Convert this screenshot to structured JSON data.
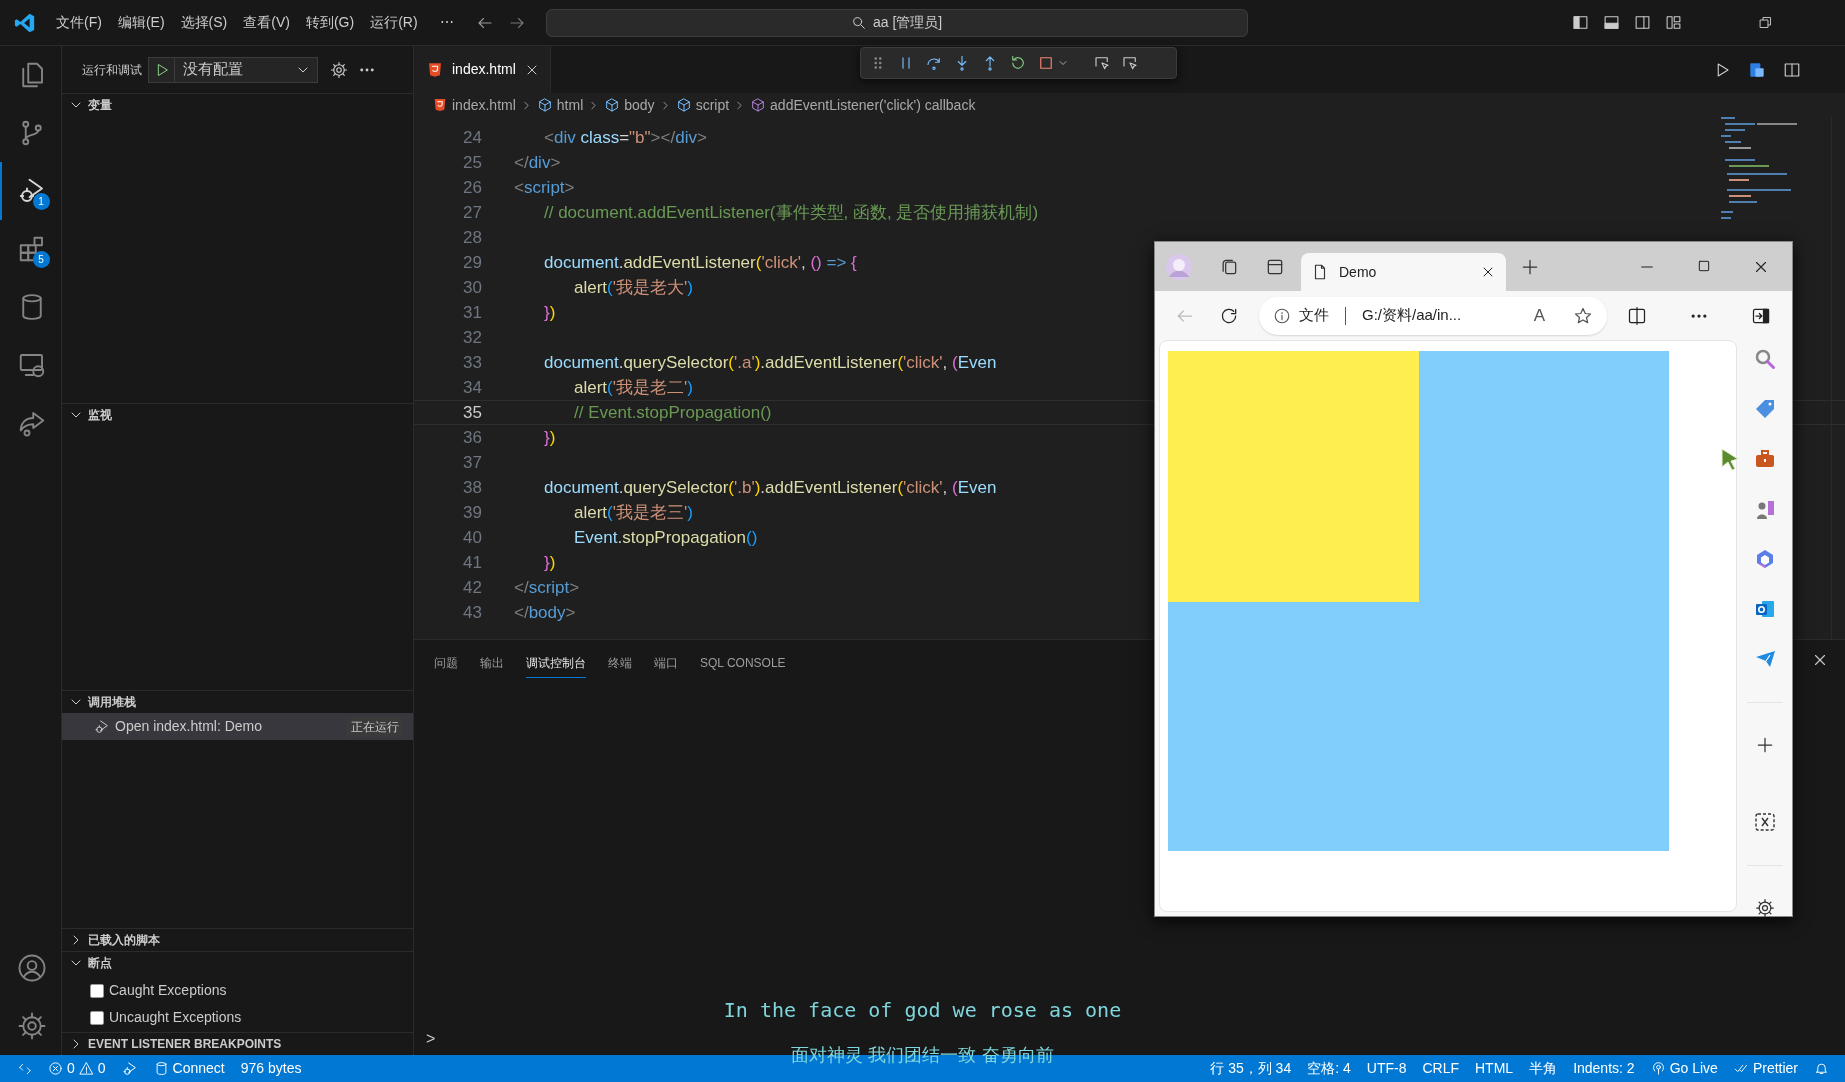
{
  "title_bar": {
    "menus": [
      "文件(F)",
      "编辑(E)",
      "选择(S)",
      "查看(V)",
      "转到(G)",
      "运行(R)"
    ],
    "more": "⋯",
    "search": "aa [管理员]"
  },
  "activity_bar": {
    "items": [
      {
        "kind": "files",
        "selected": false
      },
      {
        "kind": "scm",
        "selected": false
      },
      {
        "kind": "debug",
        "selected": true,
        "badge": "1"
      },
      {
        "kind": "extensions",
        "selected": false,
        "badge": "5"
      },
      {
        "kind": "database",
        "selected": false
      },
      {
        "kind": "remote",
        "selected": false
      },
      {
        "kind": "share",
        "selected": false
      }
    ],
    "bottom": [
      {
        "kind": "account"
      },
      {
        "kind": "settings"
      }
    ]
  },
  "sidebar": {
    "title": "运行和调试",
    "config": "没有配置",
    "sections": [
      {
        "title": "变量",
        "expanded": true
      },
      {
        "title": "监视",
        "expanded": true
      },
      {
        "title": "调用堆栈",
        "expanded": true,
        "items": [
          {
            "kind": "session",
            "label": "Open index.html: Demo",
            "status": "正在运行",
            "selected": true
          }
        ]
      },
      {
        "title": "已载入的脚本",
        "expanded": false
      },
      {
        "title": "断点",
        "expanded": true,
        "items": [
          {
            "kind": "check",
            "label": "Caught Exceptions",
            "checked": false
          },
          {
            "kind": "check",
            "label": "Uncaught Exceptions",
            "checked": false
          }
        ]
      },
      {
        "title": "EVENT LISTENER BREAKPOINTS",
        "expanded": false
      }
    ]
  },
  "editor": {
    "tab": {
      "label": "index.html",
      "selected": true
    },
    "breadcrumbs": [
      {
        "kind": "file",
        "label": "index.html"
      },
      {
        "kind": "element",
        "label": "html"
      },
      {
        "kind": "element",
        "label": "body"
      },
      {
        "kind": "element",
        "label": "script"
      },
      {
        "kind": "method",
        "label": "addEventListener('click') callback"
      }
    ],
    "lines": [
      {
        "number": "24",
        "current": false,
        "tokens": [
          {
            "kind": "bracket",
            "text": "    <"
          },
          {
            "kind": "tag",
            "text": "div"
          },
          {
            "kind": "attr",
            "text": " class"
          },
          {
            "kind": "plain",
            "text": "="
          },
          {
            "kind": "string",
            "text": "\"b\""
          },
          {
            "kind": "bracket",
            "text": "></"
          },
          {
            "kind": "tag",
            "text": "div"
          },
          {
            "kind": "bracket",
            "text": ">"
          }
        ]
      },
      {
        "number": "25",
        "current": false,
        "tokens": [
          {
            "kind": "bracket",
            "text": "</"
          },
          {
            "kind": "tag",
            "text": "div"
          },
          {
            "kind": "bracket",
            "text": ">"
          }
        ]
      },
      {
        "number": "26",
        "current": false,
        "tokens": [
          {
            "kind": "bracket",
            "text": "<"
          },
          {
            "kind": "tag",
            "text": "script"
          },
          {
            "kind": "bracket",
            "text": ">"
          }
        ]
      },
      {
        "number": "27",
        "current": false,
        "tokens": [
          {
            "kind": "comment",
            "text": "    // document.addEventListener(事件类型, 函数, 是否使用捕获机制)"
          }
        ]
      },
      {
        "number": "28",
        "current": false
      },
      {
        "number": "29",
        "current": false,
        "tokens": [
          {
            "kind": "var",
            "text": "    document"
          },
          {
            "kind": "plain",
            "text": "."
          },
          {
            "kind": "func",
            "text": "addEventListener"
          },
          {
            "kind": "paren1",
            "text": "("
          },
          {
            "kind": "string",
            "text": "'click'"
          },
          {
            "kind": "plain",
            "text": ", "
          },
          {
            "kind": "paren2",
            "text": "()"
          },
          {
            "kind": "keyword",
            "text": " =>"
          },
          {
            "kind": "paren2",
            "text": " {"
          }
        ]
      },
      {
        "number": "30",
        "current": false,
        "tokens": [
          {
            "kind": "func",
            "text": "        alert"
          },
          {
            "kind": "paren3",
            "text": "("
          },
          {
            "kind": "string",
            "text": "'我是老大'"
          },
          {
            "kind": "paren3",
            "text": ")"
          }
        ]
      },
      {
        "number": "31",
        "current": false,
        "tokens": [
          {
            "kind": "paren2",
            "text": "    }"
          },
          {
            "kind": "paren1",
            "text": ")"
          }
        ]
      },
      {
        "number": "32",
        "current": false
      },
      {
        "number": "33",
        "current": false,
        "tokens": [
          {
            "kind": "var",
            "text": "    document"
          },
          {
            "kind": "plain",
            "text": "."
          },
          {
            "kind": "func",
            "text": "querySelector"
          },
          {
            "kind": "paren1",
            "text": "("
          },
          {
            "kind": "string",
            "text": "'.a'"
          },
          {
            "kind": "paren1",
            "text": ")"
          },
          {
            "kind": "plain",
            "text": "."
          },
          {
            "kind": "func",
            "text": "addEventListener"
          },
          {
            "kind": "paren1",
            "text": "("
          },
          {
            "kind": "string",
            "text": "'click'"
          },
          {
            "kind": "plain",
            "text": ", "
          },
          {
            "kind": "paren2",
            "text": "("
          },
          {
            "kind": "var",
            "text": "Even"
          }
        ]
      },
      {
        "number": "34",
        "current": false,
        "tokens": [
          {
            "kind": "func",
            "text": "        alert"
          },
          {
            "kind": "paren3",
            "text": "("
          },
          {
            "kind": "string",
            "text": "'我是老二'"
          },
          {
            "kind": "paren3",
            "text": ")"
          }
        ]
      },
      {
        "number": "35",
        "current": true,
        "tokens": [
          {
            "kind": "comment",
            "text": "        // Event.stopPropagation()"
          }
        ]
      },
      {
        "number": "36",
        "current": false,
        "tokens": [
          {
            "kind": "paren2",
            "text": "    }"
          },
          {
            "kind": "paren1",
            "text": ")"
          }
        ]
      },
      {
        "number": "37",
        "current": false
      },
      {
        "number": "38",
        "current": false,
        "tokens": [
          {
            "kind": "var",
            "text": "    document"
          },
          {
            "kind": "plain",
            "text": "."
          },
          {
            "kind": "func",
            "text": "querySelector"
          },
          {
            "kind": "paren1",
            "text": "("
          },
          {
            "kind": "string",
            "text": "'.b'"
          },
          {
            "kind": "paren1",
            "text": ")"
          },
          {
            "kind": "plain",
            "text": "."
          },
          {
            "kind": "func",
            "text": "addEventListener"
          },
          {
            "kind": "paren1",
            "text": "("
          },
          {
            "kind": "string",
            "text": "'click'"
          },
          {
            "kind": "plain",
            "text": ", "
          },
          {
            "kind": "paren2",
            "text": "("
          },
          {
            "kind": "var",
            "text": "Even"
          }
        ]
      },
      {
        "number": "39",
        "current": false,
        "tokens": [
          {
            "kind": "func",
            "text": "        alert"
          },
          {
            "kind": "paren3",
            "text": "("
          },
          {
            "kind": "string",
            "text": "'我是老三'"
          },
          {
            "kind": "paren3",
            "text": ")"
          }
        ]
      },
      {
        "number": "40",
        "current": false,
        "tokens": [
          {
            "kind": "var",
            "text": "        Event"
          },
          {
            "kind": "plain",
            "text": "."
          },
          {
            "kind": "func",
            "text": "stopPropagation"
          },
          {
            "kind": "paren3",
            "text": "()"
          }
        ]
      },
      {
        "number": "41",
        "current": false,
        "tokens": [
          {
            "kind": "paren2",
            "text": "    }"
          },
          {
            "kind": "paren1",
            "text": ")"
          }
        ]
      },
      {
        "number": "42",
        "current": false,
        "tokens": [
          {
            "kind": "bracket",
            "text": "</"
          },
          {
            "kind": "tag",
            "text": "script"
          },
          {
            "kind": "bracket",
            "text": ">"
          }
        ]
      },
      {
        "number": "43",
        "current": false,
        "tokens": [
          {
            "kind": "bracket",
            "text": "</"
          },
          {
            "kind": "tag",
            "text": "body"
          },
          {
            "kind": "bracket",
            "text": ">"
          }
        ]
      }
    ]
  },
  "panel": {
    "tabs": [
      {
        "label": "问题",
        "selected": false
      },
      {
        "label": "输出",
        "selected": false
      },
      {
        "label": "调试控制台",
        "selected": true
      },
      {
        "label": "终端",
        "selected": false
      },
      {
        "label": "端口",
        "selected": false
      },
      {
        "label": "SQL CONSOLE",
        "selected": false
      }
    ],
    "prompt": ">"
  },
  "browser": {
    "tab": "Demo",
    "address_label": "文件",
    "url": "G:/资料/aa/in...",
    "read_aloud": "A"
  },
  "status_bar": {
    "left": [
      {
        "kind": "remote"
      },
      {
        "kind": "problems",
        "errors": "0",
        "warnings": "0"
      },
      {
        "kind": "debug"
      },
      {
        "kind": "database",
        "text": "Connect"
      },
      {
        "kind": "plain",
        "text": "976 bytes"
      }
    ],
    "right": [
      {
        "kind": "plain",
        "text": "行 35，列 34"
      },
      {
        "kind": "plain",
        "text": "空格: 4"
      },
      {
        "kind": "plain",
        "text": "UTF-8"
      },
      {
        "kind": "plain",
        "text": "CRLF"
      },
      {
        "kind": "plain",
        "text": "HTML"
      },
      {
        "kind": "plain",
        "text": "半角"
      },
      {
        "kind": "plain",
        "text": "Indents: 2"
      },
      {
        "kind": "golive",
        "text": "Go Live"
      },
      {
        "kind": "prettier",
        "text": "Prettier"
      },
      {
        "kind": "bell"
      }
    ]
  },
  "subtitles": [
    "In the face of god we rose as one",
    "面对神灵 我们团结一致 奋勇向前"
  ]
}
